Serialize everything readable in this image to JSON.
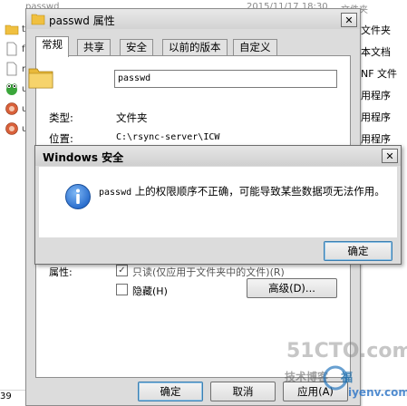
{
  "background": {
    "header_name": "passwd",
    "header_date": "2015/11/17 18:30",
    "header_type": "文件夹",
    "list_stubs": [
      "t",
      "f",
      "r",
      "u",
      "u",
      "u"
    ],
    "type_column": [
      "文件夹",
      "本文档",
      "NF 文件",
      "用程序",
      "用程序",
      "用程序"
    ],
    "status_text": "39"
  },
  "properties": {
    "title": "passwd 属性",
    "close_glyph": "✕",
    "tabs": [
      {
        "label": "常规"
      },
      {
        "label": "共享"
      },
      {
        "label": "安全"
      },
      {
        "label": "以前的版本"
      },
      {
        "label": "自定义"
      }
    ],
    "folder_name": "passwd",
    "type_label": "类型:",
    "type_value": "文件夹",
    "location_label": "位置:",
    "location_value": "C:\\rsync-server\\ICW",
    "attributes_label": "属性:",
    "readonly_label": "只读(仅应用于文件夹中的文件)(R)",
    "hidden_label": "隐藏(H)",
    "advanced_button": "高级(D)...",
    "ok_button": "确定",
    "cancel_button": "取消",
    "apply_button": "应用(A)"
  },
  "alert": {
    "title": "Windows 安全",
    "close_glyph": "✕",
    "message_name": "passwd",
    "message_rest": " 上的权限顺序不正确，可能导致某些数据项无法作用。",
    "ok_button": "确定"
  },
  "watermark": {
    "brand": "51CTO.com",
    "sub": "技术博客",
    "fu": "福",
    "url": "iyenv.com"
  },
  "colors": {
    "window_bg": "#dcdcdc",
    "info_blue": "#1f64c8",
    "folder_yellow": "#f3c647"
  }
}
